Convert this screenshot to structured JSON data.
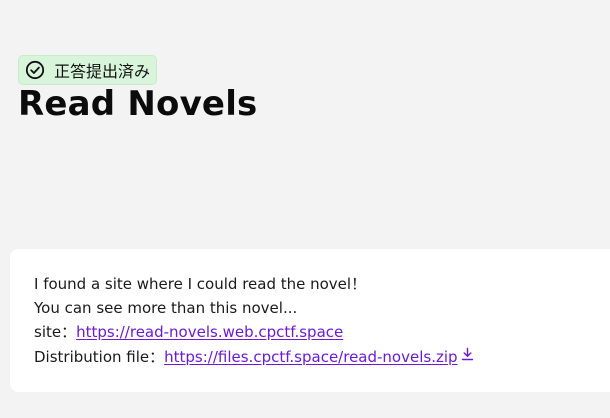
{
  "status": {
    "label": "正答提出済み",
    "icon": "check-circle-icon",
    "color": "#d8f5dc"
  },
  "problem": {
    "title": "Read Novels",
    "description": {
      "line1": "I found a site where I could read the novel！",
      "line2": "You can see more than this novel...",
      "site_prefix": "site：",
      "site_link": "https://read-novels.web.cpctf.space",
      "distribution_prefix": "Distribution file：",
      "distribution_link": "https://files.cpctf.space/read-novels.zip",
      "distribution_icon": "download-icon"
    }
  },
  "colors": {
    "link": "#6a1ad8",
    "background": "#f3f3f3",
    "card": "#ffffff"
  }
}
